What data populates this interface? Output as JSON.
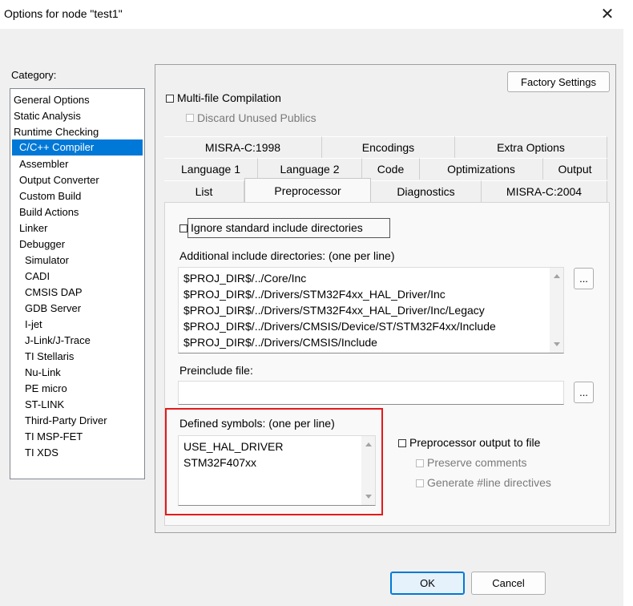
{
  "window": {
    "title": "Options for node \"test1\"",
    "close_icon": "✕"
  },
  "category": {
    "label": "Category:",
    "items": [
      {
        "label": "General Options"
      },
      {
        "label": "Static Analysis"
      },
      {
        "label": "Runtime Checking"
      },
      {
        "label": "C/C++ Compiler"
      },
      {
        "label": "Assembler"
      },
      {
        "label": "Output Converter"
      },
      {
        "label": "Custom Build"
      },
      {
        "label": "Build Actions"
      },
      {
        "label": "Linker"
      },
      {
        "label": "Debugger"
      },
      {
        "label": "Simulator"
      },
      {
        "label": "CADI"
      },
      {
        "label": "CMSIS DAP"
      },
      {
        "label": "GDB Server"
      },
      {
        "label": "I-jet"
      },
      {
        "label": "J-Link/J-Trace"
      },
      {
        "label": "TI Stellaris"
      },
      {
        "label": "Nu-Link"
      },
      {
        "label": "PE micro"
      },
      {
        "label": "ST-LINK"
      },
      {
        "label": "Third-Party Driver"
      },
      {
        "label": "TI MSP-FET"
      },
      {
        "label": "TI XDS"
      }
    ],
    "selected": "C/C++ Compiler"
  },
  "factory_settings": "Factory Settings",
  "multifile": {
    "label": "Multi-file Compilation",
    "discard": "Discard Unused Publics"
  },
  "tabs": {
    "row1": [
      "MISRA-C:1998",
      "Encodings",
      "Extra Options"
    ],
    "row2": [
      "Language 1",
      "Language 2",
      "Code",
      "Optimizations",
      "Output"
    ],
    "row3": [
      "List",
      "Preprocessor",
      "Diagnostics",
      "MISRA-C:2004"
    ],
    "active": "Preprocessor"
  },
  "preprocessor": {
    "ignore_std": "Ignore standard include directories",
    "include_label": "Additional include directories: (one per line)",
    "include_dirs": [
      "$PROJ_DIR$/../Core/Inc",
      "$PROJ_DIR$/../Drivers/STM32F4xx_HAL_Driver/Inc",
      "$PROJ_DIR$/../Drivers/STM32F4xx_HAL_Driver/Inc/Legacy",
      "$PROJ_DIR$/../Drivers/CMSIS/Device/ST/STM32F4xx/Include",
      "$PROJ_DIR$/../Drivers/CMSIS/Include"
    ],
    "browse": "...",
    "preinclude_label": "Preinclude file:",
    "preinclude_value": "",
    "defined_label": "Defined symbols: (one per line)",
    "defined_symbols": [
      "USE_HAL_DRIVER",
      "STM32F407xx"
    ],
    "pp_output": "Preprocessor output to file",
    "preserve": "Preserve comments",
    "generate": "Generate #line directives"
  },
  "buttons": {
    "ok": "OK",
    "cancel": "Cancel"
  }
}
